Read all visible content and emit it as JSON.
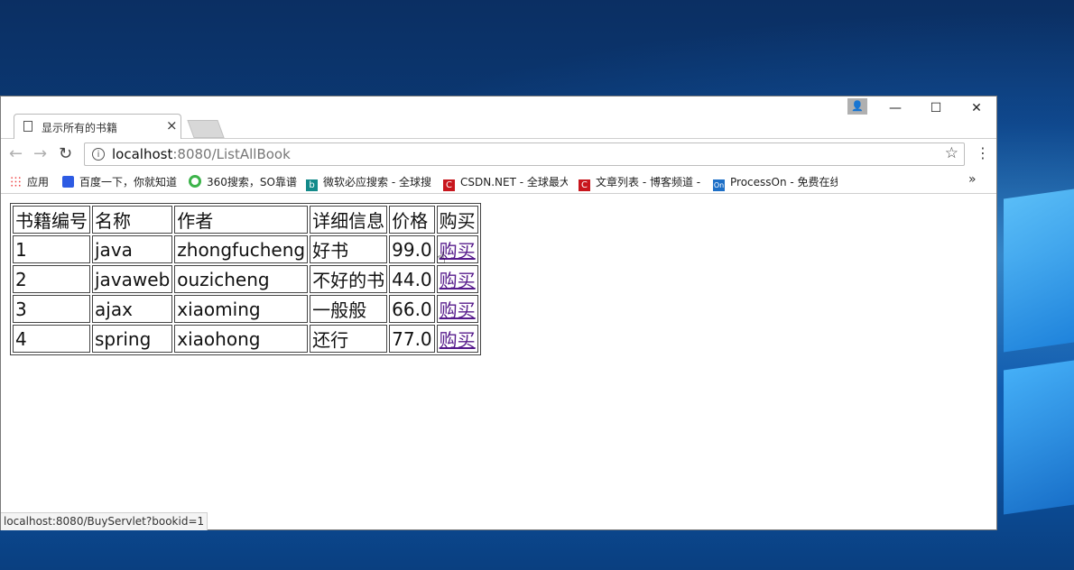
{
  "window": {
    "tab_title": "显示所有的书籍",
    "close_glyph": "×",
    "profile_glyph": "👤",
    "min_glyph": "—",
    "max_glyph": "☐",
    "close_window_glyph": "✕"
  },
  "toolbar": {
    "back_glyph": "←",
    "forward_glyph": "→",
    "reload_glyph": "↻",
    "url_host": "localhost",
    "url_path": ":8080/ListAllBook",
    "star_glyph": "☆",
    "menu_glyph": "⋮"
  },
  "bookmarks": {
    "items": [
      {
        "label": "应用",
        "icon": "apps-grid-icon"
      },
      {
        "label": "百度一下，你就知道",
        "icon": "baidu-paw-icon"
      },
      {
        "label": "360搜索，SO靠谱",
        "icon": "360-ring-icon"
      },
      {
        "label": "微软必应搜索 - 全球搜",
        "icon": "bing-icon"
      },
      {
        "label": "CSDN.NET - 全球最大",
        "icon": "csdn-icon"
      },
      {
        "label": "文章列表 - 博客频道 -",
        "icon": "csdn-blog-icon"
      },
      {
        "label": "ProcessOn - 免费在线",
        "icon": "processon-icon"
      }
    ],
    "bing_glyph": "b",
    "csdn_glyph": "C",
    "processon_glyph": "On",
    "more_glyph": "»"
  },
  "table": {
    "headers": [
      "书籍编号",
      "名称",
      "作者",
      "详细信息",
      "价格",
      "购买"
    ],
    "rows": [
      {
        "id": "1",
        "name": "java",
        "author": "zhongfucheng",
        "detail": "好书",
        "price": "99.0",
        "buy": "购买"
      },
      {
        "id": "2",
        "name": "javaweb",
        "author": "ouzicheng",
        "detail": "不好的书",
        "price": "44.0",
        "buy": "购买"
      },
      {
        "id": "3",
        "name": "ajax",
        "author": "xiaoming",
        "detail": "一般般",
        "price": "66.0",
        "buy": "购买"
      },
      {
        "id": "4",
        "name": "spring",
        "author": "xiaohong",
        "detail": "还行",
        "price": "77.0",
        "buy": "购买"
      }
    ]
  },
  "status": {
    "link_preview": "localhost:8080/BuyServlet?bookid=1"
  },
  "colors": {
    "link_visited": "#551a8b",
    "desktop_blue": "#0a4284"
  }
}
